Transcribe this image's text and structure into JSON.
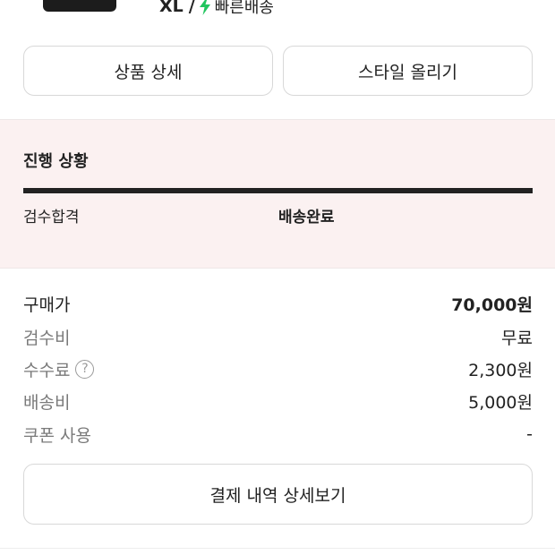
{
  "product": {
    "size": "XL",
    "separator": "/",
    "shipping": "빠른배송",
    "bolt_color": "#22c55e"
  },
  "buttons": {
    "detail": "상품 상세",
    "style": "스타일 올리기",
    "payment_detail": "결제 내역 상세보기"
  },
  "progress": {
    "title": "진행 상황",
    "steps": [
      "검수합격",
      "배송완료"
    ],
    "completion": 1.0
  },
  "price_summary": [
    {
      "label": "구매가",
      "value": "70,000원",
      "help": false
    },
    {
      "label": "검수비",
      "value": "무료",
      "help": false
    },
    {
      "label": "수수료",
      "value": "2,300원",
      "help": true,
      "help_glyph": "?"
    },
    {
      "label": "배송비",
      "value": "5,000원",
      "help": false
    },
    {
      "label": "쿠폰 사용",
      "value": "-",
      "help": false
    }
  ]
}
